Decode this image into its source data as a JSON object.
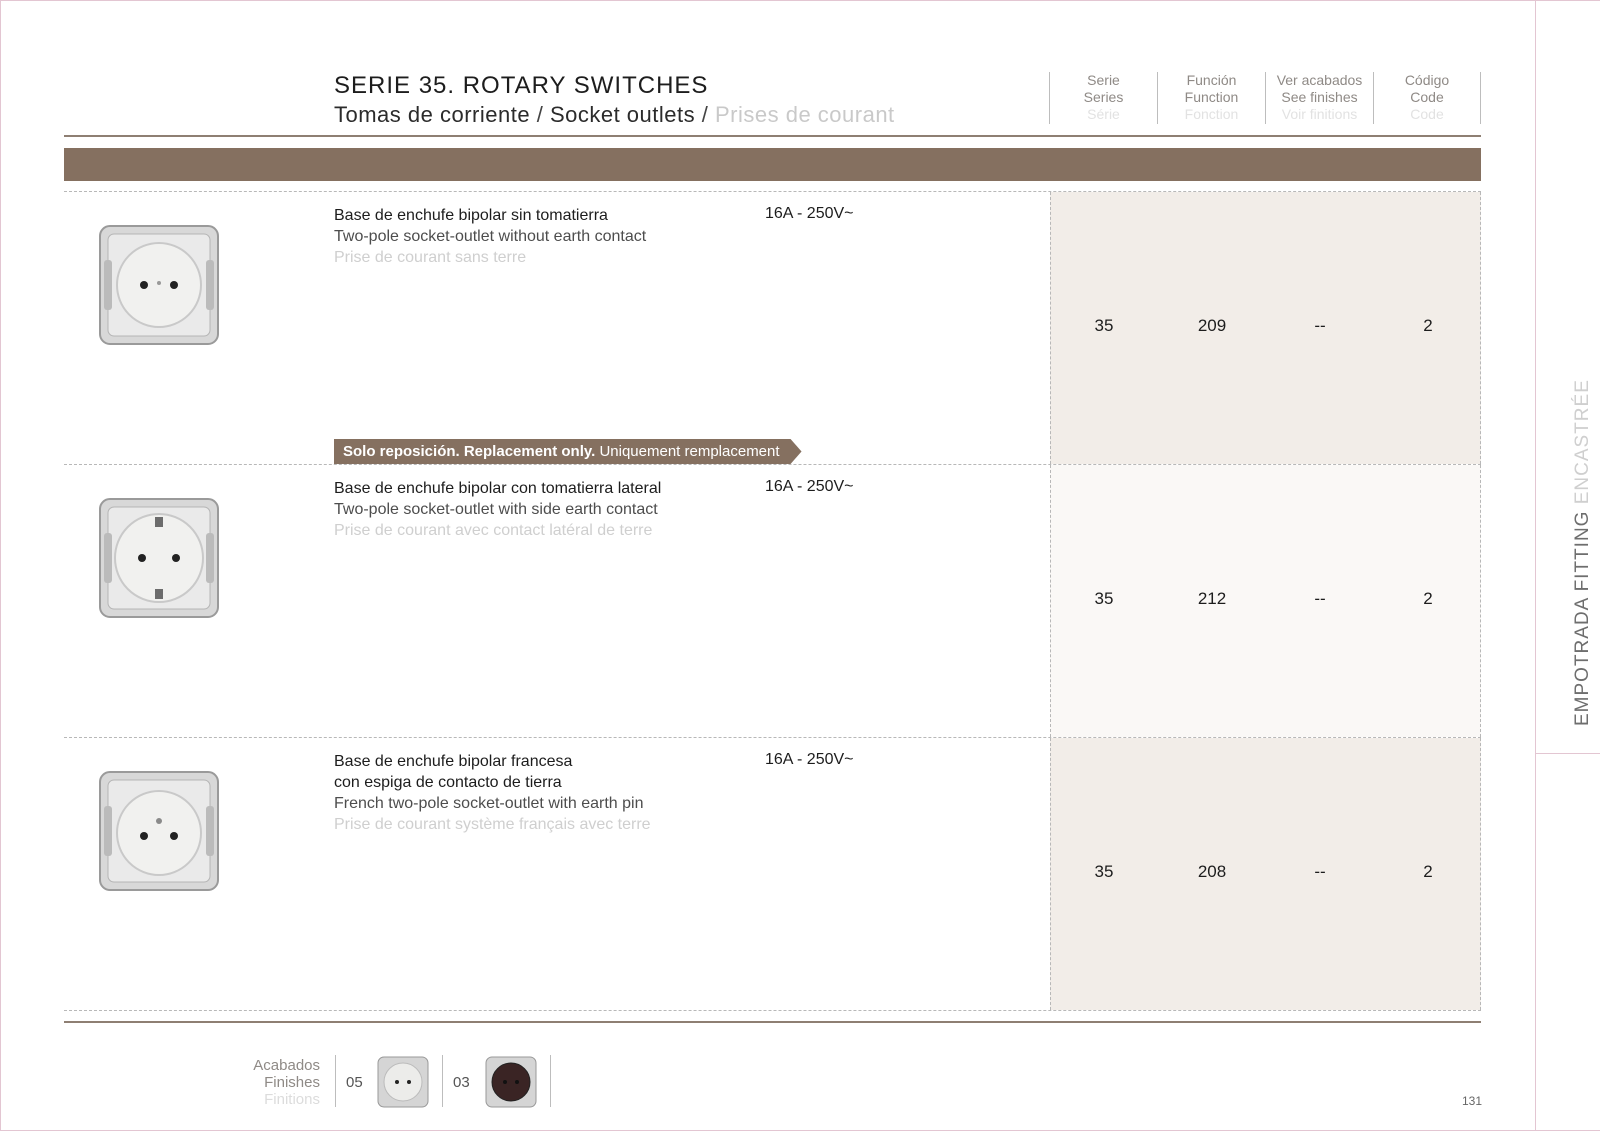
{
  "header": {
    "title": "SERIE 35. ROTARY SWITCHES",
    "subtitle_es": "Tomas de corriente",
    "subtitle_sep1": " / ",
    "subtitle_en": "Socket outlets",
    "subtitle_sep2": " / ",
    "subtitle_fr": "Prises de courant"
  },
  "columns": [
    {
      "es": "Serie",
      "en": "Series",
      "fr": "Série"
    },
    {
      "es": "Función",
      "en": "Function",
      "fr": "Fonction"
    },
    {
      "es": "Ver acabados",
      "en": "See finishes",
      "fr": "Voir finitions"
    },
    {
      "es": "Código",
      "en": "Code",
      "fr": "Code"
    }
  ],
  "products": [
    {
      "es": "Base de enchufe bipolar sin tomatierra",
      "en": "Two-pole socket-outlet without earth contact",
      "fr": "Prise de courant sans terre",
      "rating": "16A - 250V~",
      "serie": "35",
      "funcion": "209",
      "acabados": "--",
      "codigo": "2"
    },
    {
      "es": "Base de enchufe bipolar con tomatierra lateral",
      "en": "Two-pole socket-outlet with side earth contact",
      "fr": "Prise de courant avec contact latéral de terre",
      "rating": "16A - 250V~",
      "serie": "35",
      "funcion": "212",
      "acabados": "--",
      "codigo": "2"
    },
    {
      "es": "Base de enchufe bipolar francesa",
      "es2": "con espiga de contacto de tierra",
      "en": "French two-pole socket-outlet with earth pin",
      "fr": "Prise de courant système français avec terre",
      "rating": "16A - 250V~",
      "serie": "35",
      "funcion": "208",
      "acabados": "--",
      "codigo": "2"
    }
  ],
  "tag": {
    "bold": "Solo reposición. Replacement only.",
    "normal": " Uniquement remplacement"
  },
  "finishes": {
    "label_es": "Acabados",
    "label_en": "Finishes",
    "label_fr": "Finitions",
    "items": [
      {
        "code": "05",
        "color": "#e9e9e9"
      },
      {
        "code": "03",
        "color": "#3a2424"
      }
    ]
  },
  "side_tab": {
    "dark": "EMPOTRADA FITTING",
    "light": " ENCASTRÉE"
  },
  "page_number": "131",
  "colors": {
    "accent_brown": "#857060",
    "rule_brown": "#8e7f73",
    "cell_shade": "#f2ede8"
  }
}
